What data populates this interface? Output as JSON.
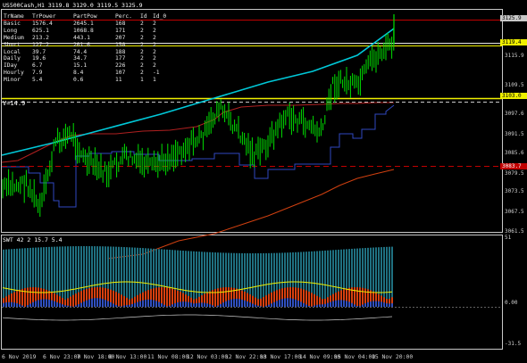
{
  "window": {
    "title": "US500Cash,H1  3119.8 3129.0 3119.5 3125.9",
    "indicator_label": "SWT 42 2 15.7 5.4",
    "v_label": "V=14.9"
  },
  "table": {
    "headers": [
      "TrName",
      "TrPower",
      "PartPow",
      "Perc.",
      "Id",
      "Id_0"
    ],
    "rows": [
      [
        "Basic",
        "1576.4",
        "2645.1",
        "168",
        "2",
        "2"
      ],
      [
        "Long",
        "625.1",
        "1068.8",
        "171",
        "2",
        "2"
      ],
      [
        "Medium",
        "213.2",
        "443.1",
        "207",
        "2",
        "2"
      ],
      [
        "Short",
        "127.2",
        "201.6",
        "158",
        "2",
        "2"
      ],
      [
        "Local",
        "39.7",
        "74.4",
        "188",
        "2",
        "2"
      ],
      [
        "Daily",
        "19.6",
        "34.7",
        "177",
        "2",
        "2"
      ],
      [
        "IDay",
        "6.7",
        "15.1",
        "226",
        "2",
        "2"
      ],
      [
        "Hourly",
        "7.9",
        "8.4",
        "107",
        "2",
        "-1"
      ],
      [
        "Minor",
        "5.4",
        "0.6",
        "11",
        "1",
        "1"
      ]
    ]
  },
  "price_axis": {
    "ticks": [
      "3115.9",
      "3109.5",
      "3097.6",
      "3091.5",
      "3085.6",
      "3079.5",
      "3073.5",
      "3067.5",
      "3061.5"
    ],
    "highlights": [
      {
        "value": "3125.9",
        "bg": "#c8c8c8",
        "fg": "#000000"
      },
      {
        "value": "3119.4",
        "bg": "#f0f000",
        "fg": "#000000"
      },
      {
        "value": "3103.0",
        "bg": "#f0f000",
        "fg": "#000000"
      },
      {
        "value": "3083.7",
        "bg": "#c00000",
        "fg": "#ffffff"
      }
    ]
  },
  "indicator_axis": {
    "ticks": [
      "51",
      "0.00",
      "-31.5"
    ]
  },
  "time_axis": {
    "labels": [
      "6 Nov 2019",
      "6 Nov 23:00",
      "7 Nov 18:00",
      "8 Nov 13:00",
      "11 Nov 08:00",
      "12 Nov 03:00",
      "12 Nov 22:00",
      "13 Nov 17:00",
      "14 Nov 09:00",
      "15 Nov 04:00",
      "15 Nov 20:00"
    ]
  },
  "colors": {
    "background": "#000000",
    "candles": "#00e000",
    "trend_line": "#00c8d8",
    "frame": "#e8e8e8",
    "support": "#f0f000",
    "resistance": "#c00000",
    "upper_band": "#c02020",
    "lower_band": "#3048c0",
    "ma": "#d04010"
  }
}
